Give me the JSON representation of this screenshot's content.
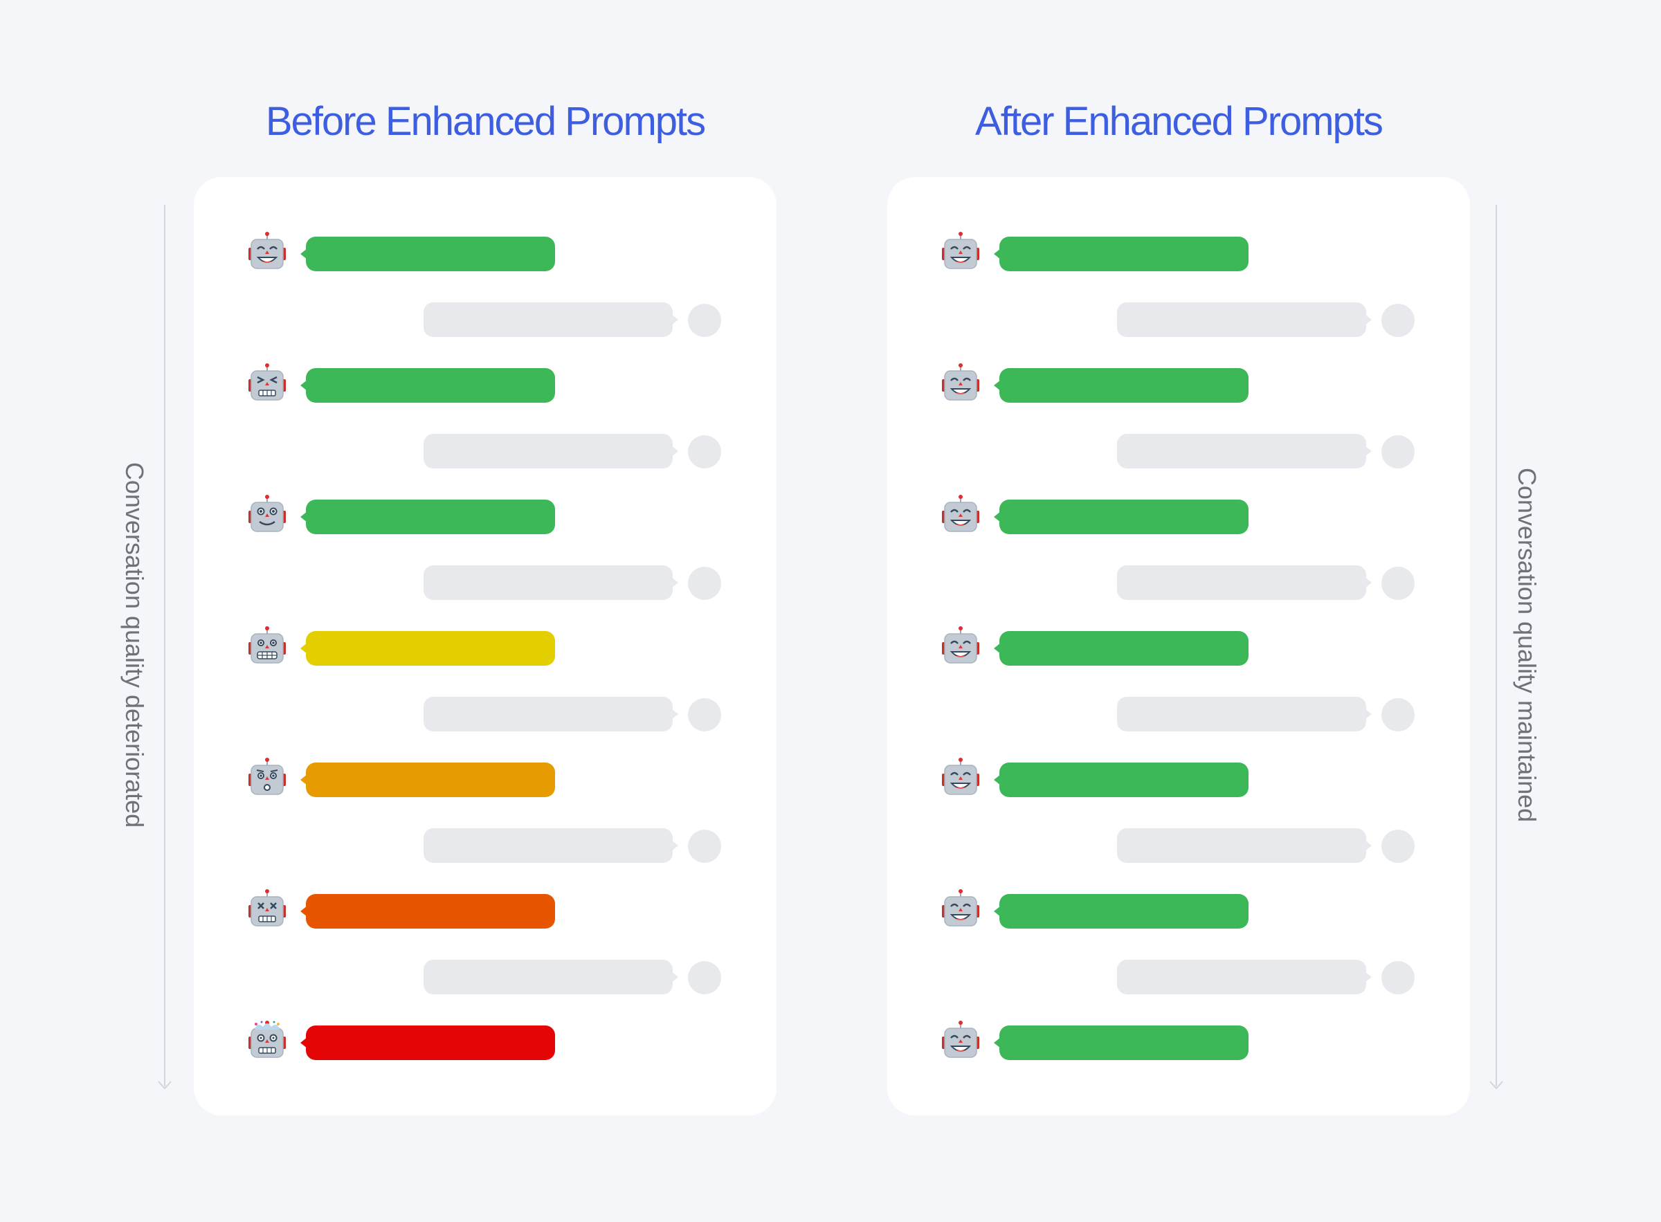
{
  "titles": {
    "before": "Before Enhanced Prompts",
    "after": "After Enhanced Prompts"
  },
  "side_labels": {
    "left": "Conversation quality deteriorated",
    "right": "Conversation quality maintained"
  },
  "colors": {
    "title": "#3d5ee1",
    "user_bubble": "#e8e9ec",
    "quality_good": "#3cb858",
    "quality_fair": "#e3cf00",
    "quality_declining": "#e69b00",
    "quality_poor": "#e85500",
    "quality_failed": "#e40606"
  },
  "before": {
    "bot_turns": [
      {
        "face": "happy",
        "quality": "good"
      },
      {
        "face": "squint",
        "quality": "good"
      },
      {
        "face": "neutral",
        "quality": "good"
      },
      {
        "face": "grimace",
        "quality": "fair"
      },
      {
        "face": "worried",
        "quality": "declining"
      },
      {
        "face": "dizzy",
        "quality": "poor"
      },
      {
        "face": "exploding",
        "quality": "failed"
      }
    ]
  },
  "after": {
    "bot_turns": [
      {
        "face": "happy",
        "quality": "good"
      },
      {
        "face": "happy",
        "quality": "good"
      },
      {
        "face": "happy",
        "quality": "good"
      },
      {
        "face": "happy",
        "quality": "good"
      },
      {
        "face": "happy",
        "quality": "good"
      },
      {
        "face": "happy",
        "quality": "good"
      },
      {
        "face": "happy",
        "quality": "good"
      }
    ]
  }
}
